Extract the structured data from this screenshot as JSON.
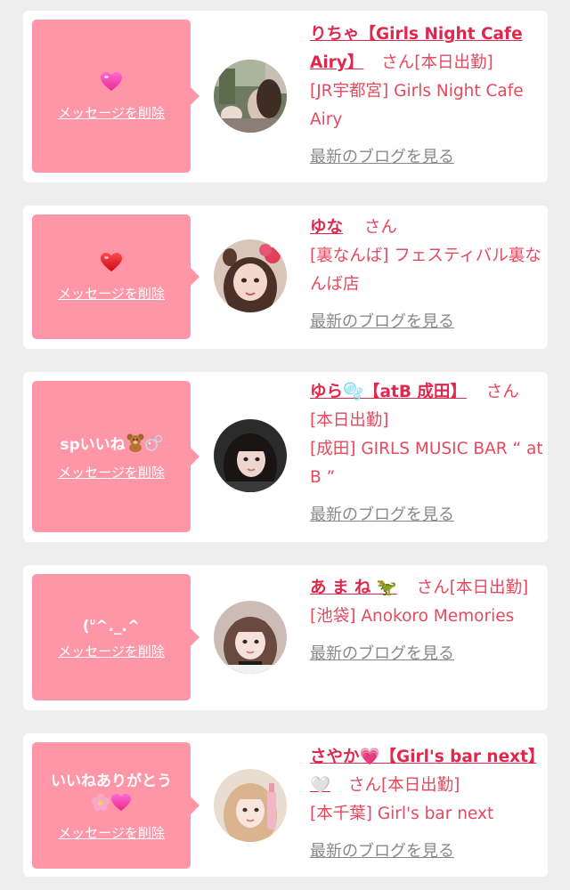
{
  "delete_label": "メッセージを削除",
  "blog_label": "最新のブログを見る",
  "honorific": "さん",
  "colors": {
    "bubble": "#ff96a8",
    "name": "#e0284c",
    "text": "#e64a5e",
    "blog_link": "#888888",
    "background": "#eeeeee"
  },
  "cards": [
    {
      "message": "",
      "message_icons": [
        "pink-heart-icon"
      ],
      "name": "りちゃ【Girls Night Cafe Airy】",
      "status": "[本日出勤]",
      "shop": "[JR宇都宮] Girls Night Cafe Airy"
    },
    {
      "message": "",
      "message_icons": [
        "red-heart-icon"
      ],
      "name": "ゆな",
      "status": "",
      "shop": "[裏なんば] フェスティバル裏なんば店"
    },
    {
      "message": "spいいね",
      "message_icons": [
        "teddy-bear-icon",
        "bubbles-icon"
      ],
      "name": "ゆら🫧【atB 成田】",
      "name_icons": [
        "bubbles-icon"
      ],
      "status": "[本日出勤]",
      "shop": "[成田] GIRLS MUSIC BAR “ at B ”"
    },
    {
      "message": "(ᐡ^._.^",
      "message_icons": [],
      "name": "あ ま ね 🦖",
      "name_icons": [
        "dinosaur-icon"
      ],
      "status": "[本日出勤]",
      "shop": "[池袋] Anokoro Memories"
    },
    {
      "message": "いいねありがとう",
      "message_icons": [
        "blossom-icon",
        "pink-heart-icon"
      ],
      "name": "さやか💗【Girl's bar next】🤍",
      "name_icons": [
        "pink-heart-icon",
        "white-heart-icon"
      ],
      "status": "[本日出勤]",
      "shop": "[本千葉] Girl's bar next"
    }
  ]
}
